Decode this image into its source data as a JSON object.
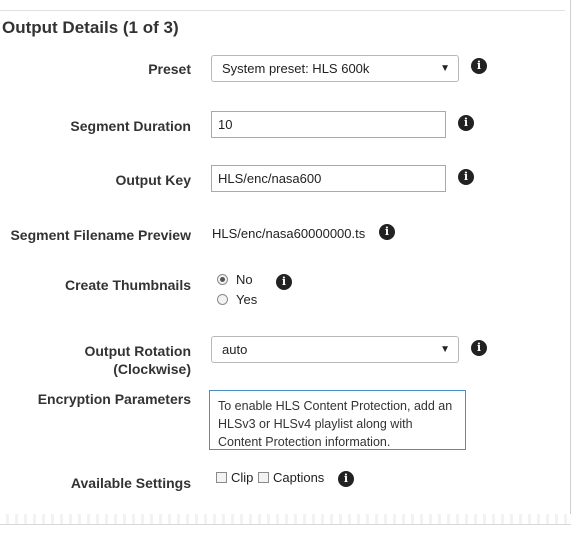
{
  "section_title": "Output Details (1 of 3)",
  "preset": {
    "label": "Preset",
    "value": "System preset: HLS 600k"
  },
  "segment_duration": {
    "label": "Segment Duration",
    "value": "10"
  },
  "output_key": {
    "label": "Output Key",
    "value": "HLS/enc/nasa600"
  },
  "segment_filename_preview": {
    "label": "Segment Filename Preview",
    "value": "HLS/enc/nasa60000000.ts"
  },
  "create_thumbnails": {
    "label": "Create Thumbnails",
    "options": [
      "No",
      "Yes"
    ],
    "selected": "No"
  },
  "output_rotation": {
    "label_line1": "Output Rotation",
    "label_line2": "(Clockwise)",
    "value": "auto"
  },
  "encryption_parameters": {
    "label": "Encryption Parameters",
    "message": "To enable HLS Content Protection, add an HLSv3 or HLSv4 playlist along with Content Protection information."
  },
  "available_settings": {
    "label": "Available Settings",
    "options": [
      "Clip",
      "Captions"
    ]
  },
  "icons": {
    "info": "info-icon",
    "dropdown": "chevron-down-icon"
  }
}
